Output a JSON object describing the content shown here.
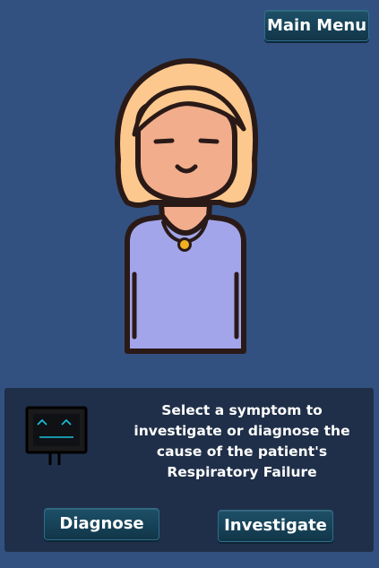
{
  "menu": {
    "main_menu_label": "Main Menu"
  },
  "patient": {
    "avatar_icon": "patient-avatar-icon",
    "colors": {
      "hair": "#fcc88e",
      "skin": "#f2ad8c",
      "shirt": "#a2a5ea",
      "outline": "#2a1a17",
      "pendant": "#f2b01f"
    }
  },
  "assistant": {
    "icon": "robot-monitor-icon",
    "screen_color": "#1a1a1a",
    "face_color": "#19c3e0",
    "message": "Select a symptom to\ninvestigate or diagnose the\ncause of the patient's\nRespiratory Failure"
  },
  "actions": {
    "diagnose_label": "Diagnose",
    "investigate_label": "Investigate"
  }
}
